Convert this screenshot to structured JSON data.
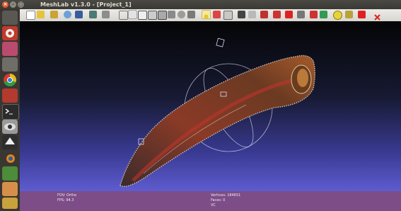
{
  "window": {
    "title": "MeshLab v1.3.0 - [Project_1]"
  },
  "launcher": {
    "items": [
      {
        "name": "dash",
        "color": "#5a5852"
      },
      {
        "name": "settings",
        "color": "#c23a2a"
      },
      {
        "name": "files",
        "color": "#b94b6e"
      },
      {
        "name": "gear",
        "color": "#6f6d68"
      },
      {
        "name": "chrome",
        "color": "#e4b21e"
      },
      {
        "name": "app-red",
        "color": "#b23a2f"
      },
      {
        "name": "terminal",
        "color": "#2b2b2b"
      },
      {
        "name": "eye",
        "color": "#9a9a9a"
      },
      {
        "name": "inkscape",
        "color": "#2e2e2e"
      },
      {
        "name": "blender",
        "color": "#e0841f"
      },
      {
        "name": "app-green",
        "color": "#4c8c3a"
      },
      {
        "name": "app-ice",
        "color": "#d68f4a"
      },
      {
        "name": "app-gold",
        "color": "#c9a23c"
      }
    ]
  },
  "toolbar": {
    "buttons": [
      "new-icon",
      "open-icon",
      "open-folder-icon",
      "reload-icon",
      "save-icon",
      "snapshot-icon",
      "layers-icon",
      "bbox-icon",
      "points-icon",
      "wireframe-icon",
      "hidden-lines-icon",
      "flat-lines-icon",
      "flat-icon",
      "smooth-icon",
      "texture-icon",
      "light-icon",
      "two-side-icon",
      "color-icon",
      "select-faces-icon",
      "select-vertices-icon",
      "cube-icon",
      "measure-icon",
      "paint-icon",
      "align-icon",
      "fill-icon",
      "pick-icon",
      "text-a-icon",
      "wand-icon",
      "stop-icon",
      "close-icon"
    ]
  },
  "status": {
    "fov": "FOV: Ortho",
    "fps": "FPS:  94.3",
    "vertices": "Vertices: 184651",
    "faces": "Faces: 0",
    "vc": "VC"
  },
  "colors": {
    "viewport_top": "#050506",
    "viewport_bottom": "#5e5cd0",
    "statusbar": "#7c4d86",
    "mesh_dark": "#4a2414",
    "mesh_light": "#a2552c"
  }
}
